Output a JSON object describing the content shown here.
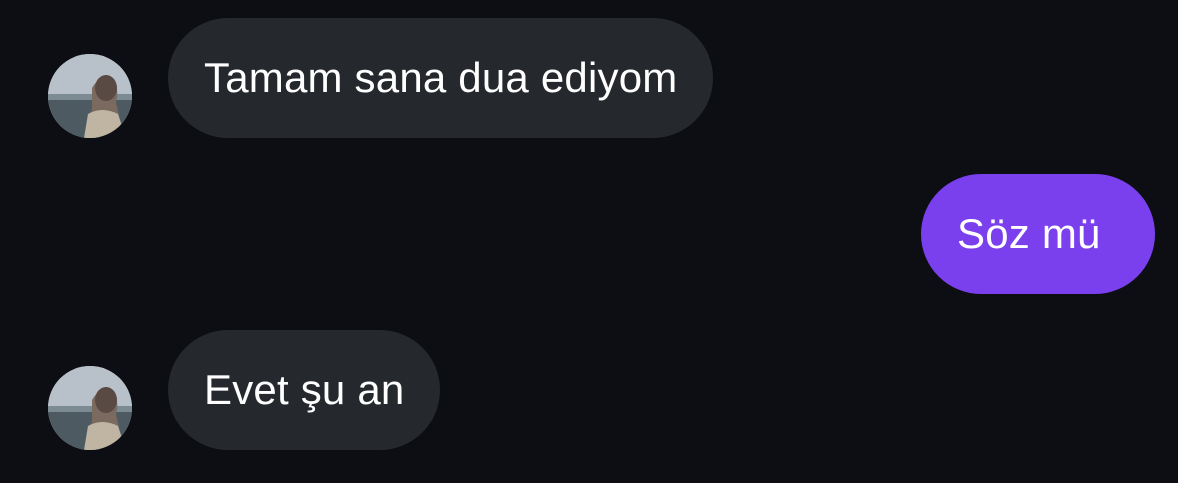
{
  "conversation": {
    "messages": [
      {
        "direction": "incoming",
        "text": "Tamam sana dua ediyom",
        "avatar_icon": "contact-avatar"
      },
      {
        "direction": "outgoing",
        "text": "Söz mü"
      },
      {
        "direction": "incoming",
        "text": "Evet şu an",
        "avatar_icon": "contact-avatar"
      }
    ]
  },
  "colors": {
    "background": "#0c0e13",
    "incoming_bubble": "#25282d",
    "outgoing_bubble": "#7b40ee",
    "text": "#ffffff"
  }
}
